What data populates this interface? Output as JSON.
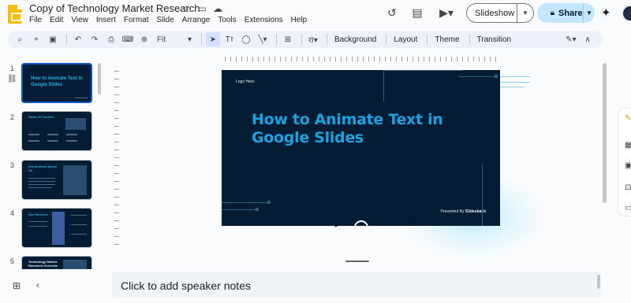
{
  "header": {
    "doc_title": "Copy of Technology Market Research",
    "menu": [
      "File",
      "Edit",
      "View",
      "Insert",
      "Format",
      "Slide",
      "Arrange",
      "Tools",
      "Extensions",
      "Help"
    ],
    "slideshow_label": "Slideshow",
    "share_label": "Share"
  },
  "toolbar": {
    "zoom": "Fit",
    "background_label": "Background",
    "layout_label": "Layout",
    "theme_label": "Theme",
    "transition_label": "Transition"
  },
  "filmstrip": {
    "slides": [
      {
        "number": "1",
        "title": "How to Animate Text in Google Slides"
      },
      {
        "number": "2",
        "title": "Table Of Content"
      },
      {
        "number": "3",
        "title": "Introduction About Us"
      },
      {
        "number": "4",
        "title": "Our Services"
      },
      {
        "number": "5",
        "title": "Technology Market Research Overview"
      }
    ]
  },
  "slide": {
    "logo_text": "Logo Here",
    "title": "How to Animate Text in Google Slides",
    "presented_prefix": "Presented By",
    "presented_by": "Slidesback"
  },
  "notes": {
    "placeholder": "Click to add speaker notes"
  },
  "colors": {
    "slide_bg": "#041c34",
    "title_accent": "#1aa3e2",
    "selection_blue": "#0b57d0",
    "share_bg": "#c2e7ff"
  }
}
